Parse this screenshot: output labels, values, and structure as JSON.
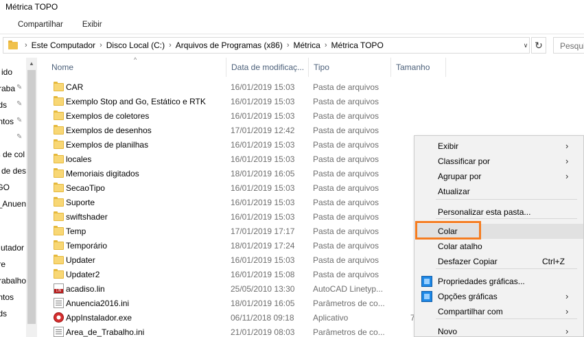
{
  "window": {
    "title": "Métrica TOPO"
  },
  "ribbon": {
    "tabs": [
      "Compartilhar",
      "Exibir"
    ]
  },
  "address": {
    "crumbs": [
      "Este Computador",
      "Disco Local (C:)",
      "Arquivos de Programas (x86)",
      "Métrica",
      "Métrica TOPO"
    ],
    "search_placeholder": "Pesqui"
  },
  "sidebar": {
    "items": [
      "ido",
      "Traba",
      "ds",
      "ntos",
      "",
      "s de col",
      "s de des",
      "GO",
      "_Anuen",
      "",
      "utador",
      "re",
      "Trabalho",
      "ntos",
      "ds"
    ]
  },
  "columns": {
    "name": "Nome",
    "date": "Data de modificaç...",
    "type": "Tipo",
    "size": "Tamanho"
  },
  "files": [
    {
      "name": "CAR",
      "date": "16/01/2019 15:03",
      "type": "Pasta de arquivos",
      "size": "",
      "icon": "folder-icon"
    },
    {
      "name": "Exemplo Stop and Go, Estático e RTK",
      "date": "16/01/2019 15:03",
      "type": "Pasta de arquivos",
      "size": "",
      "icon": "folder-icon"
    },
    {
      "name": "Exemplos de coletores",
      "date": "16/01/2019 15:03",
      "type": "Pasta de arquivos",
      "size": "",
      "icon": "folder-icon"
    },
    {
      "name": "Exemplos de desenhos",
      "date": "17/01/2019 12:42",
      "type": "Pasta de arquivos",
      "size": "",
      "icon": "folder-icon"
    },
    {
      "name": "Exemplos de planilhas",
      "date": "16/01/2019 15:03",
      "type": "Pasta de arquivos",
      "size": "",
      "icon": "folder-icon"
    },
    {
      "name": "locales",
      "date": "16/01/2019 15:03",
      "type": "Pasta de arquivos",
      "size": "",
      "icon": "folder-icon"
    },
    {
      "name": "Memoriais digitados",
      "date": "18/01/2019 16:05",
      "type": "Pasta de arquivos",
      "size": "",
      "icon": "folder-icon"
    },
    {
      "name": "SecaoTipo",
      "date": "16/01/2019 15:03",
      "type": "Pasta de arquivos",
      "size": "",
      "icon": "folder-icon"
    },
    {
      "name": "Suporte",
      "date": "16/01/2019 15:03",
      "type": "Pasta de arquivos",
      "size": "",
      "icon": "folder-icon"
    },
    {
      "name": "swiftshader",
      "date": "16/01/2019 15:03",
      "type": "Pasta de arquivos",
      "size": "",
      "icon": "folder-icon"
    },
    {
      "name": "Temp",
      "date": "17/01/2019 17:17",
      "type": "Pasta de arquivos",
      "size": "",
      "icon": "folder-icon"
    },
    {
      "name": "Temporário",
      "date": "18/01/2019 17:24",
      "type": "Pasta de arquivos",
      "size": "",
      "icon": "folder-icon"
    },
    {
      "name": "Updater",
      "date": "16/01/2019 15:03",
      "type": "Pasta de arquivos",
      "size": "",
      "icon": "folder-icon"
    },
    {
      "name": "Updater2",
      "date": "16/01/2019 15:08",
      "type": "Pasta de arquivos",
      "size": "",
      "icon": "folder-icon"
    },
    {
      "name": "acadiso.lin",
      "date": "25/05/2010 13:30",
      "type": "AutoCAD Linetyp...",
      "size": "",
      "icon": "lin-file-icon"
    },
    {
      "name": "Anuencia2016.ini",
      "date": "18/01/2019 16:05",
      "type": "Parâmetros de co...",
      "size": "",
      "icon": "ini-file-icon"
    },
    {
      "name": "AppInstalador.exe",
      "date": "06/11/2018 09:18",
      "type": "Aplicativo",
      "size": "7",
      "icon": "exe-app-icon"
    },
    {
      "name": "Area_de_Trabalho.ini",
      "date": "21/01/2019 08:03",
      "type": "Parâmetros de co...",
      "size": "",
      "icon": "ini-file-icon"
    }
  ],
  "context_menu": {
    "items": [
      {
        "label": "Exibir",
        "submenu": true
      },
      {
        "label": "Classificar por",
        "submenu": true
      },
      {
        "label": "Agrupar por",
        "submenu": true
      },
      {
        "label": "Atualizar",
        "submenu": false
      },
      {
        "label": "Personalizar esta pasta...",
        "submenu": false
      },
      {
        "label": "Colar",
        "submenu": false
      },
      {
        "label": "Colar atalho",
        "submenu": false
      },
      {
        "label": "Desfazer Copiar",
        "shortcut": "Ctrl+Z",
        "submenu": false
      },
      {
        "label": "Propriedades gráficas...",
        "submenu": false,
        "icon": "intel-graphics-icon"
      },
      {
        "label": "Opções gráficas",
        "submenu": true,
        "icon": "intel-graphics-icon"
      },
      {
        "label": "Compartilhar com",
        "submenu": true
      },
      {
        "label": "Novo",
        "submenu": true
      }
    ]
  },
  "colors": {
    "highlight": "#f57c20",
    "header_text": "#4c607a",
    "secondary_text": "#6d6d6d"
  }
}
